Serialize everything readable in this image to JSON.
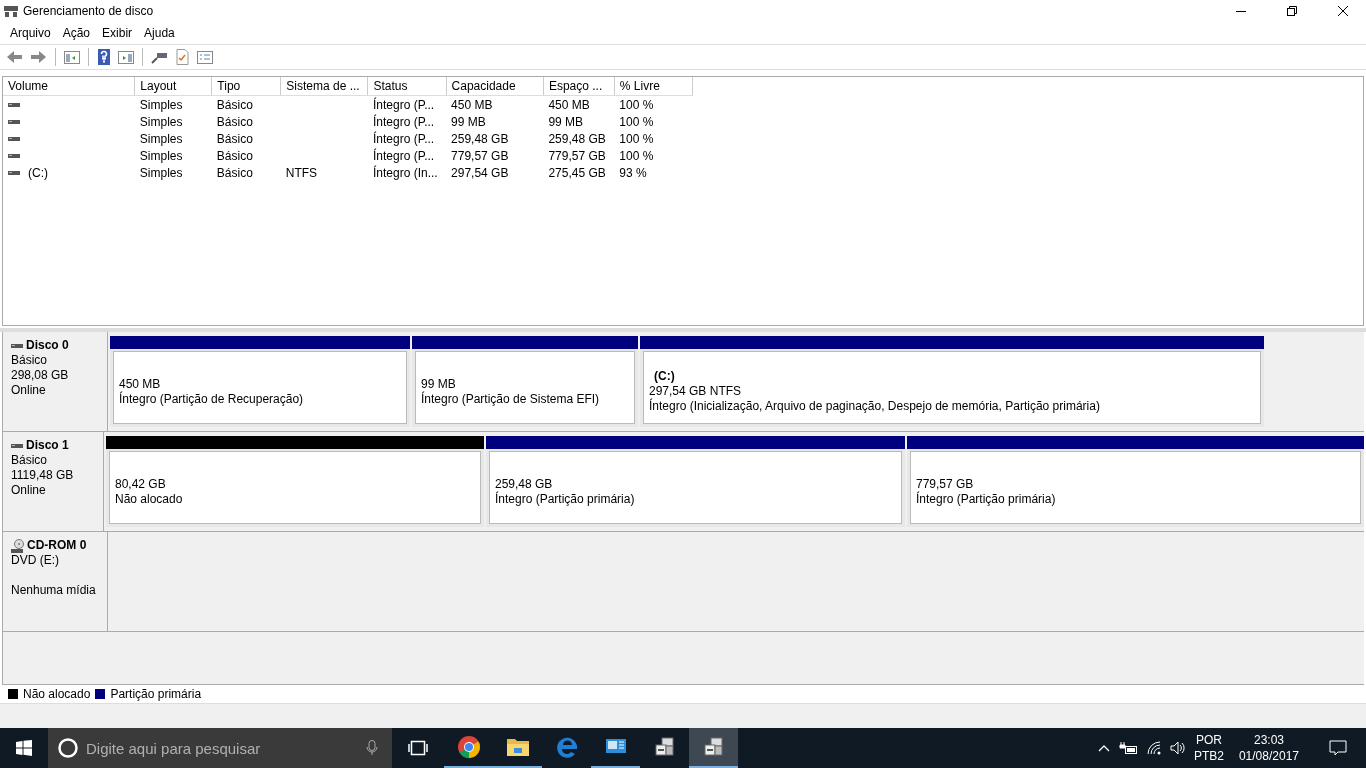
{
  "window": {
    "title": "Gerenciamento de disco"
  },
  "menu": [
    "Arquivo",
    "Ação",
    "Exibir",
    "Ajuda"
  ],
  "volume_table": {
    "columns": [
      "Volume",
      "Layout",
      "Tipo",
      "Sistema de ...",
      "Status",
      "Capacidade",
      "Espaço ...",
      "% Livre"
    ],
    "rows": [
      [
        "",
        "Simples",
        "Básico",
        "",
        "Íntegro (P...",
        "450 MB",
        "450 MB",
        "100 %"
      ],
      [
        "",
        "Simples",
        "Básico",
        "",
        "Íntegro (P...",
        "99 MB",
        "99 MB",
        "100 %"
      ],
      [
        "",
        "Simples",
        "Básico",
        "",
        "Íntegro (P...",
        "259,48 GB",
        "259,48 GB",
        "100 %"
      ],
      [
        "",
        "Simples",
        "Básico",
        "",
        "Íntegro (P...",
        "779,57 GB",
        "779,57 GB",
        "100 %"
      ],
      [
        "(C:)",
        "Simples",
        "Básico",
        "NTFS",
        "Íntegro (In...",
        "297,54 GB",
        "275,45 GB",
        "93 %"
      ]
    ]
  },
  "disks": [
    {
      "kind": "disk",
      "name": "Disco 0",
      "lines": [
        "Básico",
        "298,08 GB",
        "Online"
      ],
      "partitions": [
        {
          "kind": "primary",
          "size": "450 MB",
          "status": "Íntegro (Partição de Recuperação)"
        },
        {
          "kind": "primary",
          "size": "99 MB",
          "status": "Íntegro (Partição de Sistema EFI)"
        },
        {
          "kind": "primary",
          "label": "(C:)",
          "size": "297,54 GB NTFS",
          "status": "Íntegro (Inicialização, Arquivo de paginação, Despejo de memória, Partição primária)"
        }
      ]
    },
    {
      "kind": "disk",
      "name": "Disco 1",
      "lines": [
        "Básico",
        "1119,48 GB",
        "Online"
      ],
      "partitions": [
        {
          "kind": "unallocated",
          "size": "80,42 GB",
          "status": "Não alocado"
        },
        {
          "kind": "primary",
          "size": "259,48 GB",
          "status": "Íntegro (Partição primária)"
        },
        {
          "kind": "primary",
          "size": "779,57 GB",
          "status": "Íntegro (Partição primária)"
        }
      ]
    },
    {
      "kind": "cdrom",
      "name": "CD-ROM 0",
      "lines": [
        "DVD (E:)",
        "Nenhuma mídia"
      ]
    }
  ],
  "legend": [
    {
      "kind": "unallocated",
      "label": "Não alocado"
    },
    {
      "kind": "primary",
      "label": "Partição primária"
    }
  ],
  "taskbar": {
    "search": {
      "placeholder": "Digite aqui para pesquisar"
    },
    "apps": [
      {
        "kind": "chrome",
        "running": true,
        "selected": false
      },
      {
        "kind": "folder",
        "running": true,
        "selected": false
      },
      {
        "kind": "edge",
        "running": false,
        "selected": false
      },
      {
        "kind": "control-panel",
        "running": true,
        "selected": false
      },
      {
        "kind": "disk-tool",
        "running": false,
        "selected": false
      },
      {
        "kind": "disk-tool",
        "running": true,
        "selected": true
      }
    ],
    "language": [
      "POR",
      "PTB2"
    ],
    "time": "23:03",
    "date": "01/08/2017"
  }
}
